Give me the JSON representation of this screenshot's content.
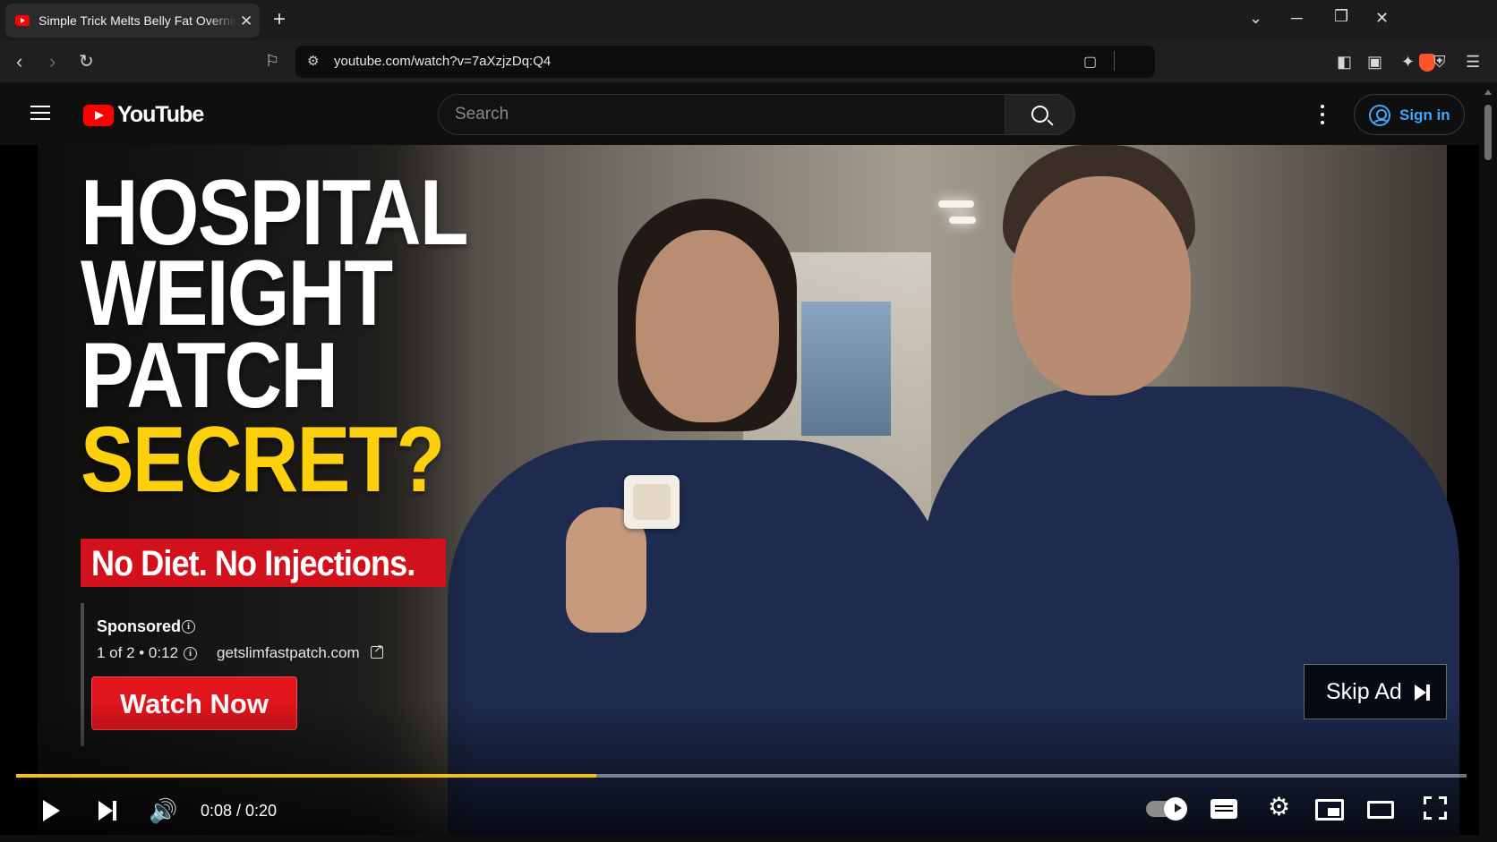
{
  "browser": {
    "tab_title": "Simple Trick Melts Belly Fat Overnight",
    "url": "youtube.com/watch?v=7aXzjzDq:Q4"
  },
  "youtube": {
    "logo_text": "YouTube",
    "search_placeholder": "Search",
    "sign_in_label": "Sign in"
  },
  "ad": {
    "headline": [
      "HOSPITAL",
      "WEIGHT",
      "PATCH",
      "SECRET?"
    ],
    "tagline": "No Diet. No Injections.",
    "sponsored_label": "Sponsored",
    "ad_count": "1 of 2 • 0:12",
    "domain": "getslimfastpatch.com",
    "cta_label": "Watch Now",
    "skip_label": "Skip Ad"
  },
  "player": {
    "timecode": "0:08 / 0:20",
    "progress_fraction": 0.4
  },
  "colors": {
    "accent_youtube_red": "#ff0000",
    "ad_progress_yellow": "#f7c300",
    "headline_yellow": "#fcd00d",
    "sign_in_blue": "#3ea6ff"
  }
}
